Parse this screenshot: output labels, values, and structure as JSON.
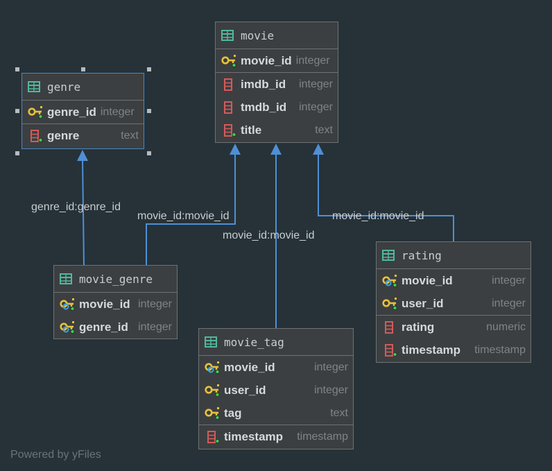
{
  "tables": {
    "movie": {
      "name": "movie",
      "columns": [
        {
          "name": "movie_id",
          "type": "integer",
          "kind": "pk"
        },
        {
          "name": "imdb_id",
          "type": "integer",
          "kind": "col"
        },
        {
          "name": "tmdb_id",
          "type": "integer",
          "kind": "col"
        },
        {
          "name": "title",
          "type": "text",
          "kind": "col-notnull"
        }
      ]
    },
    "genre": {
      "name": "genre",
      "columns": [
        {
          "name": "genre_id",
          "type": "integer",
          "kind": "pk"
        },
        {
          "name": "genre",
          "type": "text",
          "kind": "col-notnull"
        }
      ]
    },
    "movie_genre": {
      "name": "movie_genre",
      "columns": [
        {
          "name": "movie_id",
          "type": "integer",
          "kind": "pk-fk"
        },
        {
          "name": "genre_id",
          "type": "integer",
          "kind": "pk-fk"
        }
      ]
    },
    "movie_tag": {
      "name": "movie_tag",
      "columns": [
        {
          "name": "movie_id",
          "type": "integer",
          "kind": "pk-fk"
        },
        {
          "name": "user_id",
          "type": "integer",
          "kind": "pk"
        },
        {
          "name": "tag",
          "type": "text",
          "kind": "pk"
        },
        {
          "name": "timestamp",
          "type": "timestamp",
          "kind": "col-notnull"
        }
      ]
    },
    "rating": {
      "name": "rating",
      "columns": [
        {
          "name": "movie_id",
          "type": "integer",
          "kind": "pk-fk"
        },
        {
          "name": "user_id",
          "type": "integer",
          "kind": "pk"
        },
        {
          "name": "rating",
          "type": "numeric",
          "kind": "col"
        },
        {
          "name": "timestamp",
          "type": "timestamp",
          "kind": "col-notnull"
        }
      ]
    }
  },
  "relations": [
    {
      "label": "genre_id:genre_id",
      "from": "movie_genre",
      "to": "genre"
    },
    {
      "label": "movie_id:movie_id",
      "from": "movie_genre",
      "to": "movie"
    },
    {
      "label": "movie_id:movie_id",
      "from": "movie_tag",
      "to": "movie"
    },
    {
      "label": "movie_id:movie_id",
      "from": "rating",
      "to": "movie"
    }
  ],
  "colors": {
    "background": "#263238",
    "edge": "#4f8fd6",
    "key_gold": "#e8c23b",
    "fk_blue": "#3aa0e0",
    "column_red": "#d45a5a",
    "notnull_green": "#3ecf4a",
    "table_icon": "#4fb99f"
  },
  "footer": "Powered by yFiles"
}
